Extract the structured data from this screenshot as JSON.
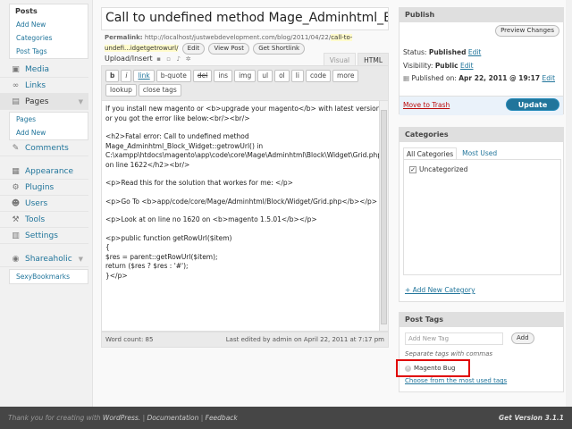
{
  "sidebar": {
    "posts_submenu": {
      "header": "Posts",
      "items": [
        "Add New",
        "Categories",
        "Post Tags"
      ]
    },
    "menu1": [
      {
        "label": "Media",
        "icon": "media-icon"
      },
      {
        "label": "Links",
        "icon": "links-icon"
      },
      {
        "label": "Pages",
        "icon": "pages-icon"
      }
    ],
    "pages_submenu": [
      "Pages",
      "Add New"
    ],
    "menu2": [
      {
        "label": "Comments",
        "icon": "comments-icon"
      }
    ],
    "menu3": [
      {
        "label": "Appearance",
        "icon": "appearance-icon"
      },
      {
        "label": "Plugins",
        "icon": "plugins-icon"
      },
      {
        "label": "Users",
        "icon": "users-icon"
      },
      {
        "label": "Tools",
        "icon": "tools-icon"
      },
      {
        "label": "Settings",
        "icon": "settings-icon"
      }
    ],
    "shareaholic": {
      "label": "Shareaholic",
      "sub": "SexyBookmarks"
    }
  },
  "editor": {
    "title": "Call to undefined method Mage_Adminhtml_B",
    "permalink_label": "Permalink:",
    "permalink_url": "http://localhost/justwebdevelopment.com/blog/2011/04/22/",
    "permalink_slug": "call-to-undefi...idgetgetrowurl/",
    "edit_btn": "Edit",
    "view_post_btn": "View Post",
    "shortlink_btn": "Get Shortlink",
    "upload_label": "Upload/Insert",
    "tab_visual": "Visual",
    "tab_html": "HTML",
    "quicktags_row1": [
      "b",
      "i",
      "link",
      "b-quote",
      "del",
      "ins",
      "img",
      "ul",
      "ol",
      "li",
      "code",
      "more"
    ],
    "quicktags_row2": [
      "lookup",
      "close tags"
    ],
    "content": [
      "If you install new magento or <b>upgrade your magento</b> with latest version or you got the error like below:<br/><br/>",
      "<h2>Fatal error: Call to undefined method Mage_Adminhtml_Block_Widget::getrowUrl() in C:\\xampp\\htdocs\\magento\\app\\code\\core\\Mage\\Adminhtml\\Block\\Widget\\Grid.php on line 1622</h2><br/>",
      "<p>Read this for the solution that workes for me: </p>",
      "<p>Go To <b>app/code/core/Mage/Adminhtml/Block/Widget/Grid.php</b></p>",
      "<p>Look at on line no 1620 on <b>magento 1.5.01</b></p>",
      "<p>public function getRowUrl($item)\n{\n$res = parent::getRowUrl($item);\nreturn ($res ? $res : '#');\n}</p>"
    ],
    "word_count": "Word count: 85",
    "last_edited": "Last edited by admin on April 22, 2011 at 7:17 pm"
  },
  "publish": {
    "header": "Publish",
    "preview_btn": "Preview Changes",
    "status_label": "Status:",
    "status_value": "Published",
    "visibility_label": "Visibility:",
    "visibility_value": "Public",
    "published_label": "Published on:",
    "published_value": "Apr 22, 2011 @ 19:17",
    "edit_link": "Edit",
    "trash_link": "Move to Trash",
    "update_btn": "Update"
  },
  "categories": {
    "header": "Categories",
    "tab_all": "All Categories",
    "tab_most_used": "Most Used",
    "items": [
      {
        "label": "Uncategorized",
        "checked": true
      }
    ],
    "add_link": "+ Add New Category"
  },
  "tags": {
    "header": "Post Tags",
    "input_placeholder": "Add New Tag",
    "add_btn": "Add",
    "hint": "Separate tags with commas",
    "items": [
      "Magento Bug"
    ],
    "most_used_link": "Choose from the most used tags"
  },
  "footer": {
    "thanks_prefix": "Thank you for creating with",
    "wordpress": "WordPress.",
    "documentation": "Documentation",
    "feedback": "Feedback",
    "version": "Get Version 3.1.1"
  }
}
